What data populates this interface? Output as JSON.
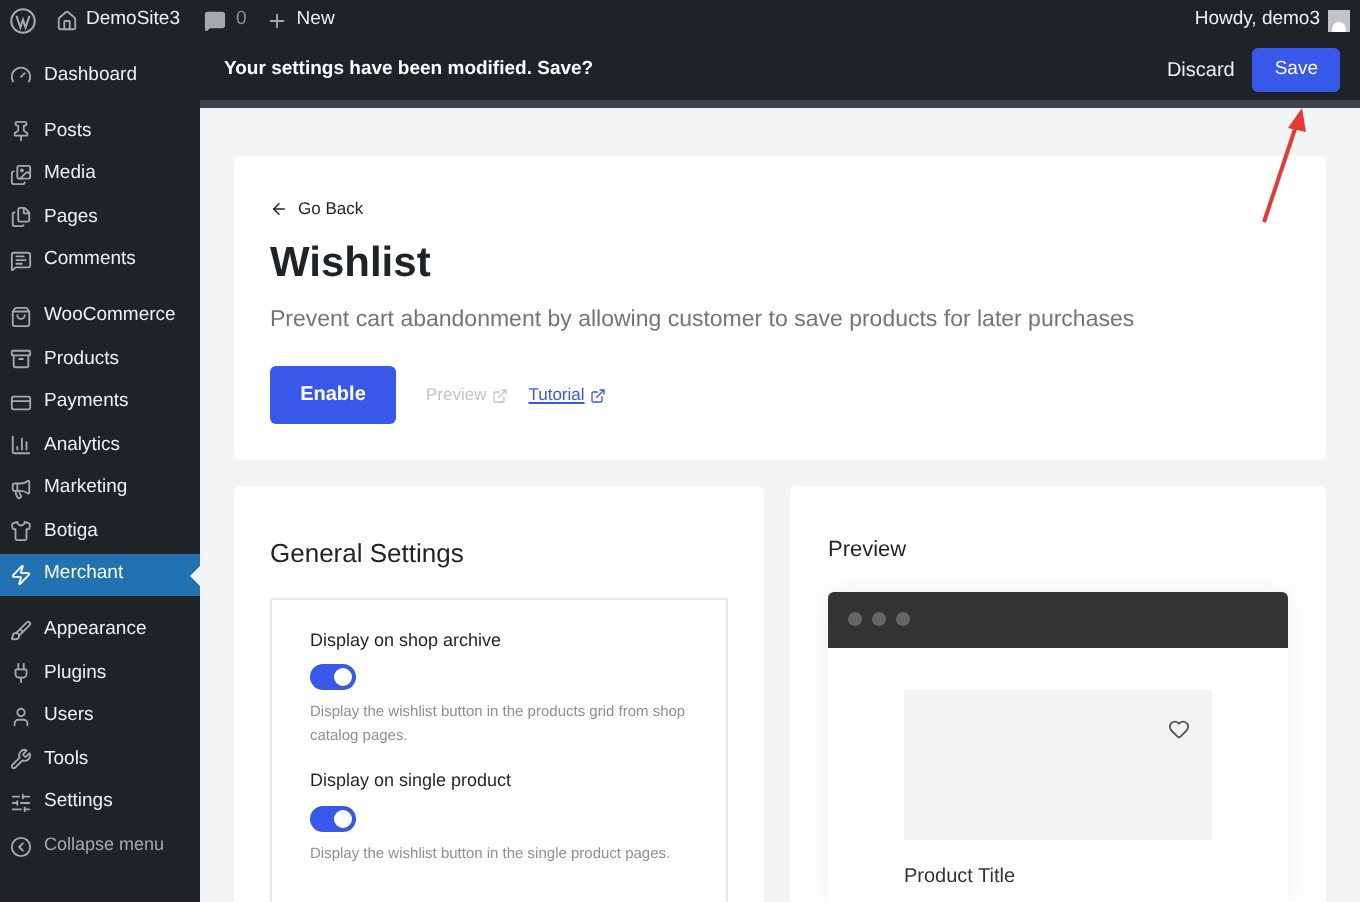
{
  "admin_bar": {
    "site_name": "DemoSite3",
    "comments_count": "0",
    "new_label": "New",
    "greeting": "Howdy, demo3"
  },
  "sidebar": {
    "groups": [
      [
        {
          "label": "Dashboard",
          "selected": false
        }
      ],
      [
        {
          "label": "Posts",
          "selected": false
        },
        {
          "label": "Media",
          "selected": false
        },
        {
          "label": "Pages",
          "selected": false
        },
        {
          "label": "Comments",
          "selected": false
        }
      ],
      [
        {
          "label": "WooCommerce",
          "selected": false
        },
        {
          "label": "Products",
          "selected": false
        },
        {
          "label": "Payments",
          "selected": false
        },
        {
          "label": "Analytics",
          "selected": false
        },
        {
          "label": "Marketing",
          "selected": false
        },
        {
          "label": "Botiga",
          "selected": false
        },
        {
          "label": "Merchant",
          "selected": true
        }
      ],
      [
        {
          "label": "Appearance",
          "selected": false
        },
        {
          "label": "Plugins",
          "selected": false
        },
        {
          "label": "Users",
          "selected": false
        },
        {
          "label": "Tools",
          "selected": false
        },
        {
          "label": "Settings",
          "selected": false
        }
      ]
    ],
    "collapse_label": "Collapse menu"
  },
  "notice_bar": {
    "message": "Your settings have been modified. Save?",
    "discard": "Discard",
    "save": "Save"
  },
  "module": {
    "back": "Go Back",
    "title": "Wishlist",
    "description": "Prevent cart abandonment by allowing customer to save products for later purchases",
    "enable": "Enable",
    "preview_link": "Preview",
    "tutorial_link": "Tutorial"
  },
  "settings": {
    "title": "General Settings",
    "options": [
      {
        "label": "Display on shop archive",
        "on": true,
        "help": "Display the wishlist button in the products grid from shop catalog pages."
      },
      {
        "label": "Display on single product",
        "on": true,
        "help": "Display the wishlist button in the single product pages."
      }
    ]
  },
  "preview": {
    "title": "Preview",
    "product_title": "Product Title"
  }
}
